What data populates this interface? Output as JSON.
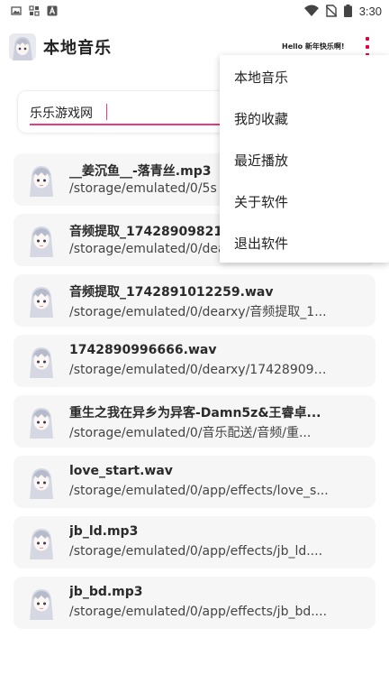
{
  "status_bar": {
    "time": "3:30",
    "left_icons": [
      "image-notification-icon",
      "grid-notification-icon",
      "text-a-notification-icon"
    ],
    "right_icons": [
      "wifi-icon",
      "no-sim-icon",
      "battery-icon"
    ]
  },
  "app_bar": {
    "title": "本地音乐",
    "hello": "Hello 新年快乐啊!"
  },
  "search": {
    "value": "乐乐游戏网",
    "underline_color": "#e83a7c"
  },
  "menu": {
    "items": [
      "本地音乐",
      "我的收藏",
      "最近播放",
      "关于软件",
      "退出软件"
    ]
  },
  "tracks": [
    {
      "title": "__姜沉鱼__-落青丝.mp3",
      "path": "/storage/emulated/0/5s"
    },
    {
      "title": "音频提取_1742890982135.wav",
      "path": "/storage/emulated/0/dearxy/"
    },
    {
      "title": "音频提取_1742891012259.wav",
      "path": "/storage/emulated/0/dearxy/音频提取_1..."
    },
    {
      "title": "1742890996666.wav",
      "path": "/storage/emulated/0/dearxy/174289099..."
    },
    {
      "title": "重生之我在异乡为异客-Damn5z&王睿卓...",
      "path": "/storage/emulated/0/音乐配送/音频/重..."
    },
    {
      "title": "love_start.wav",
      "path": "/storage/emulated/0/app/effects/love_s..."
    },
    {
      "title": "jb_ld.mp3",
      "path": "/storage/emulated/0/app/effects/jb_ld...."
    },
    {
      "title": "jb_bd.mp3",
      "path": "/storage/emulated/0/app/effects/jb_bd...."
    }
  ],
  "colors": {
    "accent": "#e4003a",
    "card_bg": "#f6f6f6"
  }
}
